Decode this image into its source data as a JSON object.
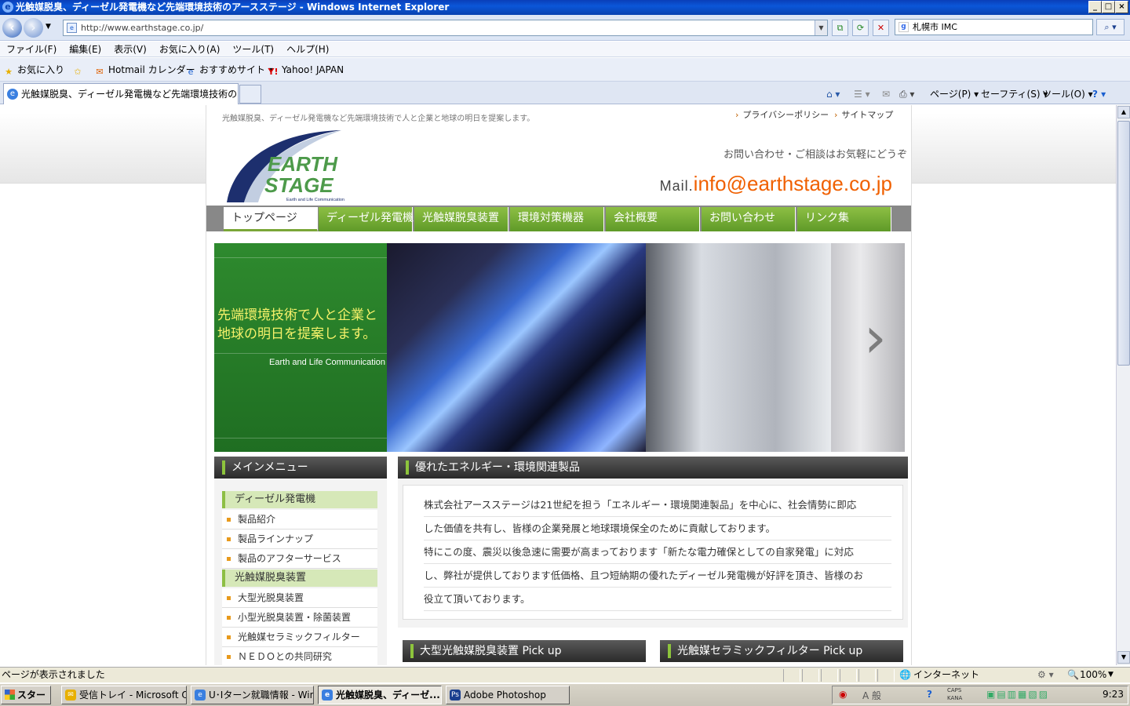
{
  "window": {
    "title": "光触媒脱臭、ディーゼル発電機など先端環境技術のアースステージ - Windows Internet Explorer",
    "btn_min": "_",
    "btn_max": "□",
    "btn_close": "×"
  },
  "address": {
    "url": "http://www.earthstage.co.jp/",
    "search_value": "札幌市 IMC"
  },
  "menu": [
    "ファイル(F)",
    "編集(E)",
    "表示(V)",
    "お気に入り(A)",
    "ツール(T)",
    "ヘルプ(H)"
  ],
  "favorites": {
    "favorites_label": "お気に入り",
    "items": [
      "Hotmail カレンダー",
      "おすすめサイト ▾",
      "Yahoo! JAPAN"
    ]
  },
  "tab": {
    "title": "光触媒脱臭、ディーゼル発電機など先端環境技術のア..."
  },
  "command_bar": [
    "ページ(P) ▾",
    "セーフティ(S) ▾",
    "ツール(O) ▾"
  ],
  "site": {
    "tagline": "光触媒脱臭、ディーゼル発電機など先端環境技術で人と企業と地球の明日を提案します。",
    "top_links": [
      "プライバシーポリシー",
      "サイトマップ"
    ],
    "logo_line1": "EARTH",
    "logo_line2": "STAGE",
    "logo_sub": "Earth and Life Communication",
    "inquiry": "お問い合わせ・ご相談はお気軽にどうぞ",
    "mail_label": "Mail.",
    "mail_address": "info@earthstage.co.jp",
    "nav": [
      "トップページ",
      "ディーゼル発電機",
      "光触媒脱臭装置",
      "環境対策機器",
      "会社概要",
      "お問い合わせ",
      "リンク集"
    ],
    "hero": {
      "headline": "先端環境技術で人と企業と地球の明日を提案します。",
      "sub": "Earth and Life Communication"
    },
    "main_menu_title": "メインメニュー",
    "main_menu": [
      {
        "type": "category",
        "label": "ディーゼル発電機"
      },
      {
        "type": "item",
        "label": "製品紹介"
      },
      {
        "type": "item",
        "label": "製品ラインナップ"
      },
      {
        "type": "item",
        "label": "製品のアフターサービス"
      },
      {
        "type": "category",
        "label": "光触媒脱臭装置"
      },
      {
        "type": "item",
        "label": "大型光脱臭装置"
      },
      {
        "type": "item",
        "label": "小型光脱臭装置・除菌装置"
      },
      {
        "type": "item",
        "label": "光触媒セラミックフィルター"
      },
      {
        "type": "item",
        "label": "ＮＥＤＯとの共同研究"
      }
    ],
    "intro_title": "優れたエネルギー・環境関連製品",
    "intro_lines": [
      "株式会社アースステージは21世紀を担う「エネルギー・環境関連製品」を中心に、社会情勢に即応",
      "した価値を共有し、皆様の企業発展と地球環境保全のために貢献しております。",
      "特にこの度、震災以後急速に需要が高まっております「新たな電力確保としての自家発電」に対応",
      "し、弊社が提供しております低価格、且つ短納期の優れたディーゼル発電機が好評を頂き、皆様のお",
      "役立て頂いております。"
    ],
    "pickup1": "大型光触媒脱臭装置 Pick up",
    "pickup2": "光触媒セラミックフィルター Pick up"
  },
  "status": {
    "text": "ページが表示されました",
    "zone": "インターネット",
    "zoom": "100%"
  },
  "taskbar": {
    "start": "スタート",
    "tasks": [
      "受信トレイ - Microsoft O...",
      "U･Iターン就職情報 - Win...",
      "光触媒脱臭、ディーゼ...",
      "Adobe Photoshop"
    ],
    "time": "9:23",
    "caps": "CAPS",
    "kana": "KANA",
    "ime": "A 般"
  },
  "colors": {
    "accent_green": "#7aa637",
    "mail_orange": "#f06000",
    "logo_navy": "#1d2f6e",
    "logo_green": "#4d9a4a"
  }
}
